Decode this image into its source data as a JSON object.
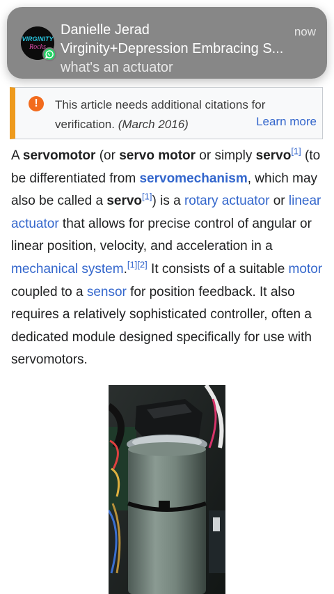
{
  "notification": {
    "sender": "Danielle Jerad",
    "time": "now",
    "group": "Virginity+Depression Embracing S...",
    "message": "what's an actuator",
    "avatar_logo_text": "VIRGINITY Rocks",
    "badge_icon": "whatsapp-icon",
    "colors": {
      "background": "#767676",
      "badge": "#25d366"
    }
  },
  "notice": {
    "icon": "exclamation-icon",
    "text": "This article needs additional citations for verification.",
    "date": "(March 2016)",
    "learn_more": "Learn more",
    "colors": {
      "border": "#ee9a1c",
      "icon": "#f26b1d"
    }
  },
  "article": {
    "t1": "A ",
    "servomotor": "servomotor",
    "t2": " (or ",
    "servo_motor": "servo motor",
    "t3": " or simply ",
    "servo": "servo",
    "ref1": "[1]",
    "t4": " (to be differentiated from ",
    "servomechanism": "servomechanism",
    "t5": ", which may also be called a ",
    "servo2": "servo",
    "ref2": "[1]",
    "t6": ") is a ",
    "rotary_actuator": "rotary actuator",
    "t7": " or ",
    "linear_actuator": "linear actuator",
    "t8": " that allows for precise control of angular or linear position, velocity, and acceleration in a ",
    "mechanical_system": "mechanical system",
    "t9": ".",
    "ref3": "[1]",
    "ref4": "[2]",
    "t10": " It consists of a suitable ",
    "motor": "motor",
    "t11": " coupled to a ",
    "sensor": "sensor",
    "t12": " for position feedback. It also requires a relatively sophisticated controller, often a dedicated module designed specifically for use with servomotors.",
    "link_color": "#3366cc"
  },
  "image": {
    "subject": "servomotor-photo"
  }
}
